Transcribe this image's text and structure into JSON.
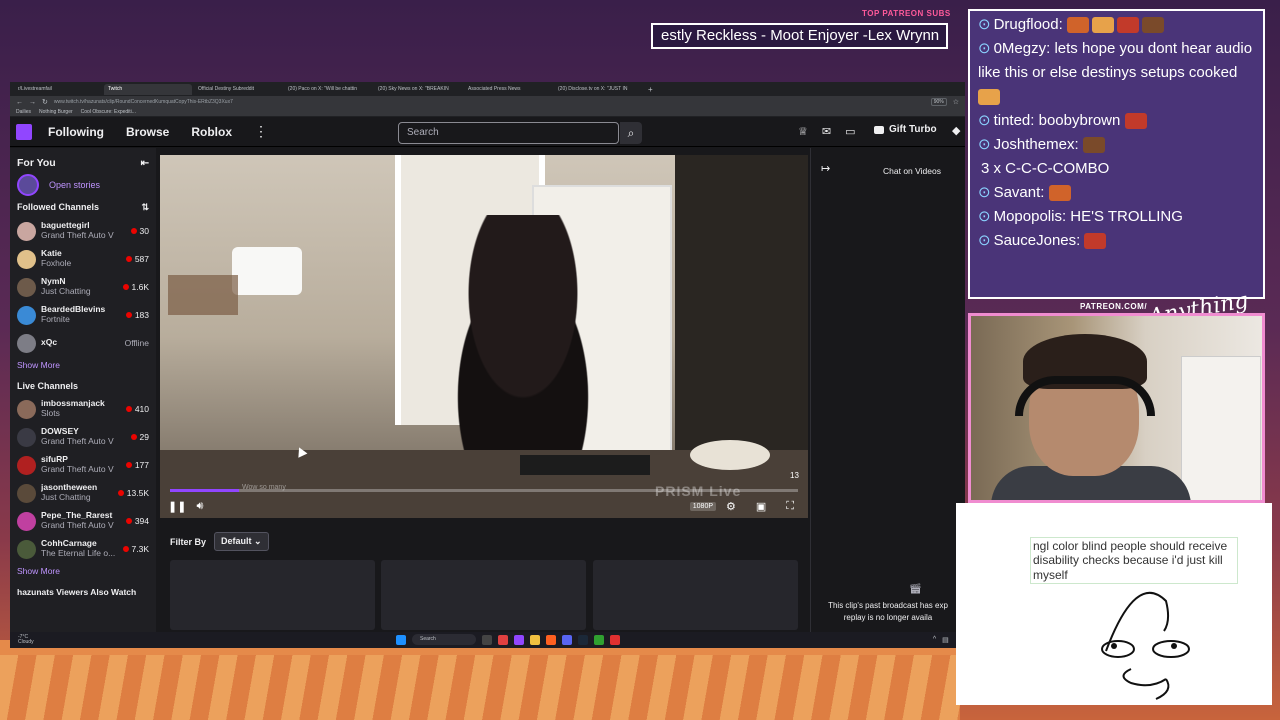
{
  "overlay": {
    "patreon_label": "TOP PATREON SUBS",
    "marquee_text": "estly Reckless - Moot Enjoyer -Lex Wrynn",
    "patreon_url": "PATREON.COM/",
    "cursive_text": "Anything Else"
  },
  "browser": {
    "tabs": [
      {
        "label": "r/Livestreamfail",
        "active": false
      },
      {
        "label": "Twitch",
        "active": true
      },
      {
        "label": "Official Destiny Subreddit",
        "active": false
      },
      {
        "label": "(20) Paco on X: \"Will be chattin",
        "active": false
      },
      {
        "label": "(20) Sky News on X: \"BREAKIN",
        "active": false
      },
      {
        "label": "Associated Press News",
        "active": false
      },
      {
        "label": "(20) Disclose.tv on X: \"JUST IN",
        "active": false
      }
    ],
    "url": "www.twitch.tv/hazunats/clip/RoundConcernedKumquatCopyThis-ERtbZ3Q3Xux7",
    "zoom": "90%",
    "bookmarks": [
      "Dailies",
      "Nothing Burger",
      "Cool Obscure: Expediti..."
    ]
  },
  "twitch": {
    "nav": {
      "following": "Following",
      "browse": "Browse",
      "roblox": "Roblox",
      "search_placeholder": "Search",
      "turbo": "Gift Turbo"
    },
    "sidebar": {
      "for_you": "For You",
      "open_stories": "Open stories",
      "followed_header": "Followed Channels",
      "followed": [
        {
          "name": "baguettegirl",
          "game": "Grand Theft Auto V",
          "viewers": "30",
          "color": "#c9a6a0"
        },
        {
          "name": "Katie",
          "game": "Foxhole",
          "viewers": "587",
          "color": "#e0c08a"
        },
        {
          "name": "NymN",
          "game": "Just Chatting",
          "viewers": "1.6K",
          "color": "#6d5a4a"
        },
        {
          "name": "BeardedBlevins",
          "game": "Fortnite",
          "viewers": "183",
          "color": "#3a8ad6"
        },
        {
          "name": "xQc",
          "game": "",
          "viewers": "Offline",
          "color": "#7d7d86"
        }
      ],
      "show_more": "Show More",
      "live_header": "Live Channels",
      "live": [
        {
          "name": "imbossmanjack",
          "game": "Slots",
          "viewers": "410",
          "color": "#8a6a5a"
        },
        {
          "name": "DOWSEY",
          "game": "Grand Theft Auto V",
          "viewers": "29",
          "color": "#3a3a44"
        },
        {
          "name": "sifuRP",
          "game": "Grand Theft Auto V",
          "viewers": "177",
          "color": "#b02020"
        },
        {
          "name": "jasontheween",
          "game": "Just Chatting",
          "viewers": "13.5K",
          "color": "#5a4a3a"
        },
        {
          "name": "Pepe_The_Rarest",
          "game": "Grand Theft Auto V",
          "viewers": "394",
          "color": "#c040a0"
        },
        {
          "name": "CohhCarnage",
          "game": "The Eternal Life o...",
          "viewers": "7.3K",
          "color": "#4a5a3a"
        }
      ],
      "show_more_2": "Show More",
      "also_watch": "hazunats Viewers Also Watch"
    },
    "player": {
      "watermark": "PRISM Live",
      "counter": "13",
      "progress_caption": "Wow so many",
      "progress": 0.11,
      "quality": "1080P"
    },
    "filter": {
      "label": "Filter By",
      "value": "Default"
    },
    "chat": {
      "title": "Chat on Videos",
      "message_line1": "This clip's past broadcast has exp",
      "message_line2": "replay is no longer availa"
    }
  },
  "taskbar": {
    "weather_temp": "-7°C",
    "weather_label": "Cloudy",
    "search": "Search"
  },
  "stream_chat": {
    "lines": [
      {
        "user": "Drugflood:",
        "text": "",
        "emotes": 4
      },
      {
        "user": "0Megzy:",
        "text": "lets hope you dont hear audio like this or else destinys setups cooked",
        "emotes": 1
      },
      {
        "user": "tinted:",
        "text": "boobybrown",
        "emotes": 1
      },
      {
        "user": "Joshthemex:",
        "text": "",
        "emotes": 1
      },
      {
        "user": "",
        "text": "3 x C-C-C-COMBO",
        "emotes": 0
      },
      {
        "user": "Savant:",
        "text": "",
        "emotes": 1
      },
      {
        "user": "Mopopolis:",
        "text": "HE'S TROLLING",
        "emotes": 0
      },
      {
        "user": "SauceJones:",
        "text": "",
        "emotes": 1
      }
    ]
  },
  "drawing": {
    "text": "ngl color blind people should receive disability checks because i'd just kill myself"
  },
  "colors": {
    "twitch_purple": "#9146ff",
    "live_red": "#eb0400",
    "overlay_bg": "#4a3478",
    "webcam_border": "#f08cd0"
  }
}
